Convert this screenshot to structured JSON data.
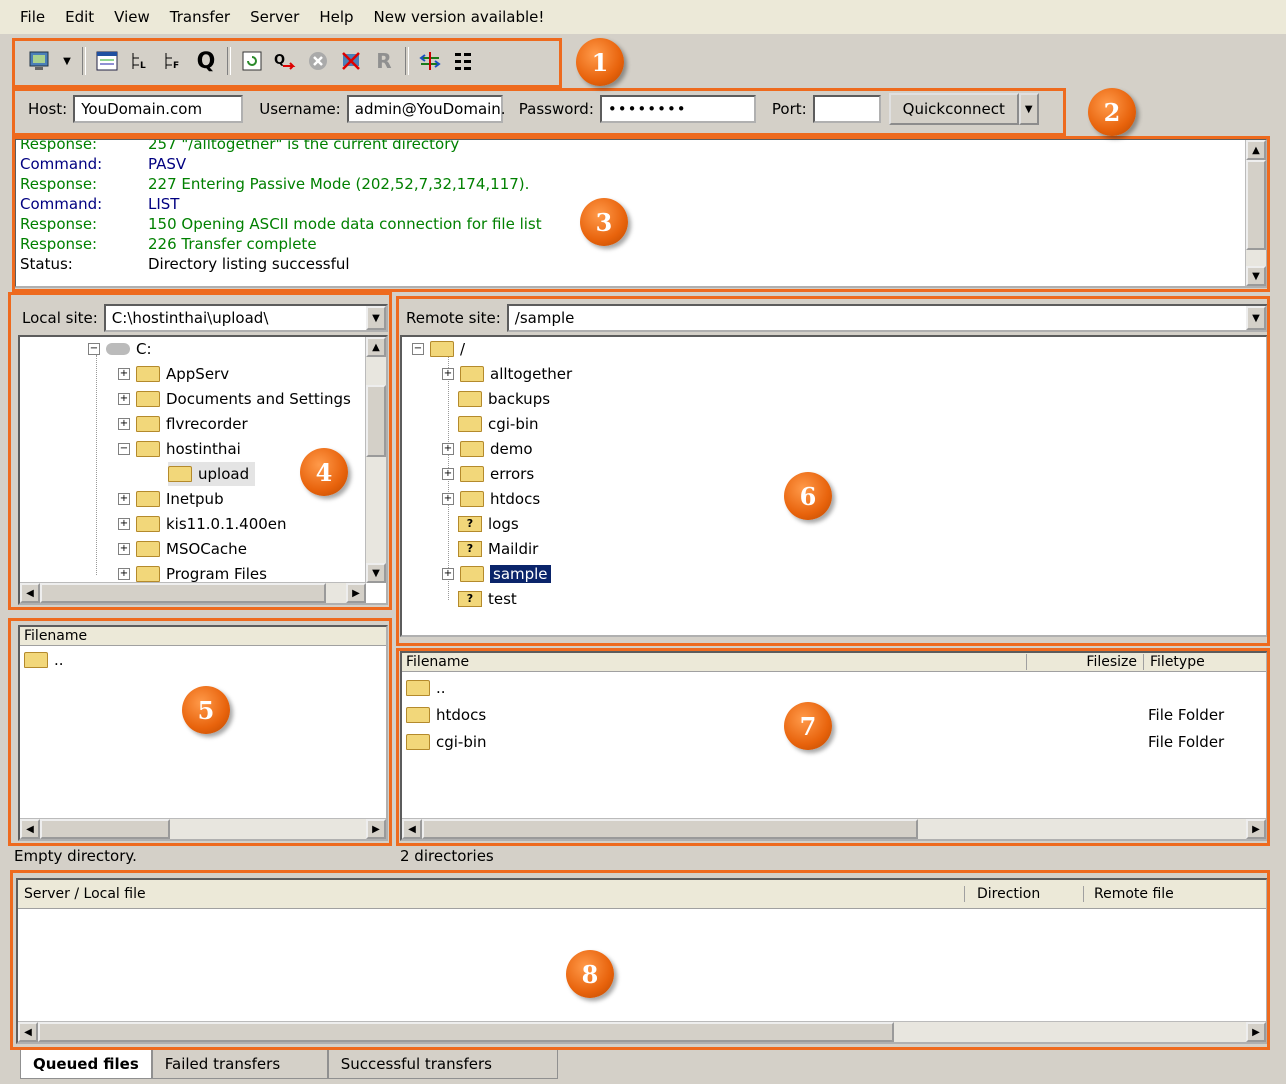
{
  "menu": [
    "File",
    "Edit",
    "View",
    "Transfer",
    "Server",
    "Help",
    "New version available!"
  ],
  "toolbar_icons": [
    "site-manager-icon",
    "dropdown-arrow-icon",
    "toggle-log-icon",
    "toggle-local-tree-icon",
    "toggle-remote-tree-icon",
    "toggle-queue-icon",
    "refresh-icon",
    "process-queue-icon",
    "cancel-icon",
    "disconnect-icon",
    "reconnect-icon",
    "compare-icon",
    "filter-icon"
  ],
  "quickconnect": {
    "host_label": "Host:",
    "host_value": "YouDomain.com",
    "username_label": "Username:",
    "username_value": "admin@YouDomain.",
    "password_label": "Password:",
    "password_value": "••••••••",
    "port_label": "Port:",
    "port_value": "",
    "button": "Quickconnect"
  },
  "log": [
    {
      "type": "Response:",
      "text": "257 \"/alltogether\" is the current directory",
      "kind": "resp"
    },
    {
      "type": "Command:",
      "text": "PASV",
      "kind": "cmd"
    },
    {
      "type": "Response:",
      "text": "227 Entering Passive Mode (202,52,7,32,174,117).",
      "kind": "resp"
    },
    {
      "type": "Command:",
      "text": "LIST",
      "kind": "cmd"
    },
    {
      "type": "Response:",
      "text": "150 Opening ASCII mode data connection for file list",
      "kind": "resp"
    },
    {
      "type": "Response:",
      "text": "226 Transfer complete",
      "kind": "resp"
    },
    {
      "type": "Status:",
      "text": "Directory listing successful",
      "kind": "status"
    }
  ],
  "local": {
    "label": "Local site:",
    "path": "C:\\hostinthai\\upload\\",
    "tree": [
      "C:",
      "AppServ",
      "Documents and Settings",
      "flvrecorder",
      "hostinthai",
      "upload",
      "Inetpub",
      "kis11.0.1.400en",
      "MSOCache",
      "Program Files"
    ],
    "list_header": "Filename",
    "files": [
      ".."
    ],
    "status": "Empty directory."
  },
  "remote": {
    "label": "Remote site:",
    "path": "/sample",
    "tree": [
      "/",
      "alltogether",
      "backups",
      "cgi-bin",
      "demo",
      "errors",
      "htdocs",
      "logs",
      "Maildir",
      "sample",
      "test"
    ],
    "headers": {
      "name": "Filename",
      "size": "Filesize",
      "type": "Filetype"
    },
    "files": [
      {
        "name": "..",
        "type": ""
      },
      {
        "name": "htdocs",
        "type": "File Folder"
      },
      {
        "name": "cgi-bin",
        "type": "File Folder"
      }
    ],
    "status": "2 directories"
  },
  "queue": {
    "headers": [
      "Server / Local file",
      "Direction",
      "Remote file"
    ],
    "tabs": [
      "Queued files",
      "Failed transfers",
      "Successful transfers"
    ]
  },
  "badges": [
    "1",
    "2",
    "3",
    "4",
    "5",
    "6",
    "7",
    "8"
  ],
  "colors": {
    "accent": "#ee6a1e",
    "response": "#008000",
    "command": "#000080",
    "selection": "#0a246a"
  }
}
